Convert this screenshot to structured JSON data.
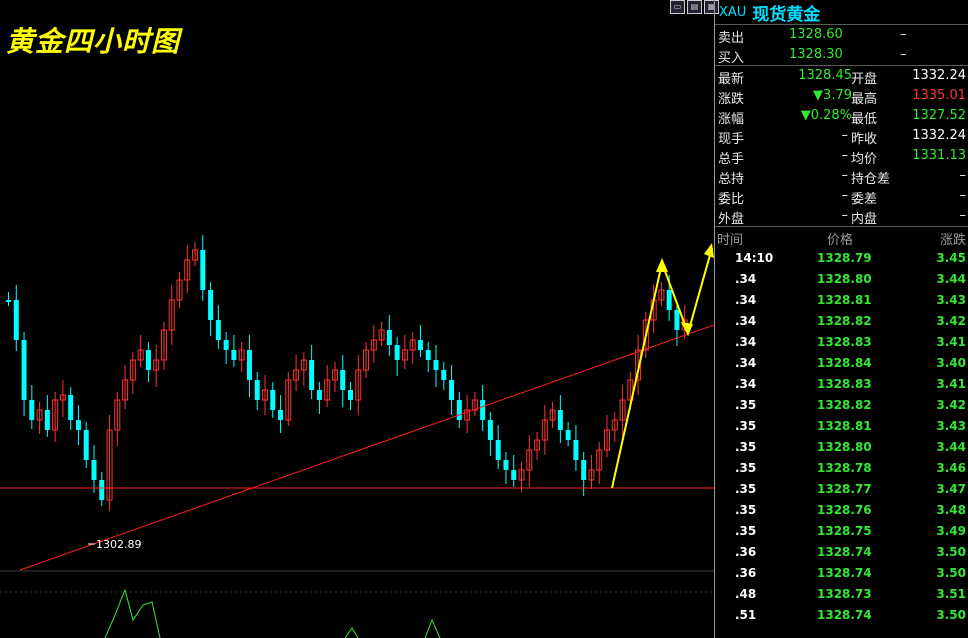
{
  "chart_title": "黄金四小时图",
  "low_label": "1302.89",
  "quote": {
    "code": "XAU",
    "name": "现货黄金",
    "sell_label": "卖出",
    "sell_value": "1328.60",
    "sell_extra": "–",
    "buy_label": "买入",
    "buy_value": "1328.30",
    "buy_extra": "–",
    "rows": [
      {
        "l1": "最新",
        "v1": "1328.45",
        "l2": "开盘",
        "v2": "1332.24"
      },
      {
        "l1": "涨跌",
        "v1": "▼3.79",
        "l2": "最高",
        "v2": "1335.01"
      },
      {
        "l1": "涨幅",
        "v1": "▼0.28%",
        "l2": "最低",
        "v2": "1327.52"
      },
      {
        "l1": "现手",
        "v1": "–",
        "l2": "昨收",
        "v2": "1332.24"
      },
      {
        "l1": "总手",
        "v1": "–",
        "l2": "均价",
        "v2": "1331.13"
      },
      {
        "l1": "总持",
        "v1": "–",
        "l2": "持仓差",
        "v2": "–"
      },
      {
        "l1": "委比",
        "v1": "–",
        "l2": "委差",
        "v2": "–"
      },
      {
        "l1": "外盘",
        "v1": "–",
        "l2": "内盘",
        "v2": "–"
      }
    ],
    "colors": {
      "up": "#ff3333",
      "down": "#33e833",
      "cyan": "#00e0ff",
      "accent": "#ffff00"
    }
  },
  "ticks_header": {
    "time": "时间",
    "price": "价格",
    "change": "涨跌"
  },
  "ticks": [
    {
      "time": "14:10",
      "price": "1328.79",
      "change": "3.45"
    },
    {
      "time": ".34",
      "price": "1328.80",
      "change": "3.44"
    },
    {
      "time": ".34",
      "price": "1328.81",
      "change": "3.43"
    },
    {
      "time": ".34",
      "price": "1328.82",
      "change": "3.42"
    },
    {
      "time": ".34",
      "price": "1328.83",
      "change": "3.41"
    },
    {
      "time": ".34",
      "price": "1328.84",
      "change": "3.40"
    },
    {
      "time": ".34",
      "price": "1328.83",
      "change": "3.41"
    },
    {
      "time": ".35",
      "price": "1328.82",
      "change": "3.42"
    },
    {
      "time": ".35",
      "price": "1328.81",
      "change": "3.43"
    },
    {
      "time": ".35",
      "price": "1328.80",
      "change": "3.44"
    },
    {
      "time": ".35",
      "price": "1328.78",
      "change": "3.46"
    },
    {
      "time": ".35",
      "price": "1328.77",
      "change": "3.47"
    },
    {
      "time": ".35",
      "price": "1328.76",
      "change": "3.48"
    },
    {
      "time": ".35",
      "price": "1328.75",
      "change": "3.49"
    },
    {
      "time": ".36",
      "price": "1328.74",
      "change": "3.50"
    },
    {
      "time": ".36",
      "price": "1328.74",
      "change": "3.50"
    },
    {
      "time": ".48",
      "price": "1328.73",
      "change": "3.51"
    },
    {
      "time": ".51",
      "price": "1328.74",
      "change": "3.50"
    }
  ]
}
